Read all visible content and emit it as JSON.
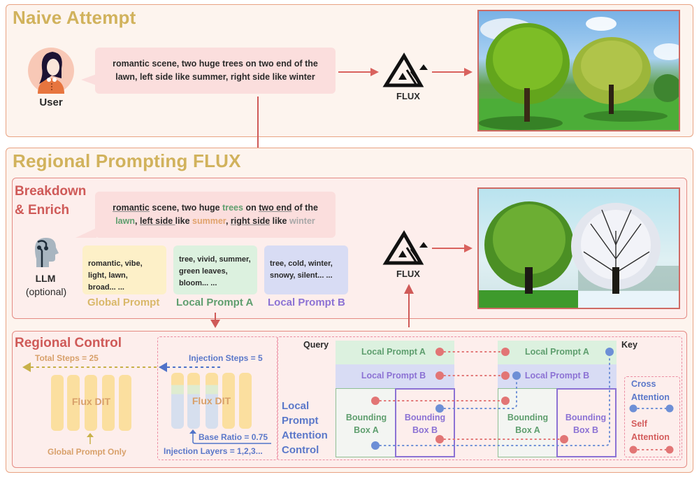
{
  "naive": {
    "title": "Naive Attempt",
    "user_label": "User",
    "prompt_line1": "romantic scene, two huge trees on two end of the",
    "prompt_line2": "lawn, left side like summer, right side like winter",
    "model_label": "FLUX",
    "output_image": "two-trees-summer-park-photo"
  },
  "regional": {
    "title": "Regional Prompting FLUX",
    "breakdown": {
      "title_line1": "Breakdown",
      "title_line2": "& Enrich",
      "prompt_tokens_line1": [
        {
          "text": "romantic",
          "style": "underline",
          "color": "#2a2a2a"
        },
        {
          "text": " scene, two huge ",
          "style": "plain",
          "color": "#2a2a2a"
        },
        {
          "text": "trees",
          "style": "plain",
          "color": "#5e9e6e"
        },
        {
          "text": " on ",
          "style": "plain",
          "color": "#2a2a2a"
        },
        {
          "text": "two end",
          "style": "underline",
          "color": "#2a2a2a"
        },
        {
          "text": " of the",
          "style": "plain",
          "color": "#2a2a2a"
        }
      ],
      "prompt_tokens_line2": [
        {
          "text": "lawn",
          "style": "plain",
          "color": "#5e9e6e"
        },
        {
          "text": ", ",
          "style": "plain",
          "color": "#2a2a2a"
        },
        {
          "text": "left side ",
          "style": "underline",
          "color": "#2a2a2a"
        },
        {
          "text": "like ",
          "style": "plain",
          "color": "#2a2a2a"
        },
        {
          "text": "summer",
          "style": "plain",
          "color": "#e0a36c"
        },
        {
          "text": ", ",
          "style": "plain",
          "color": "#2a2a2a"
        },
        {
          "text": "right side",
          "style": "underline",
          "color": "#2a2a2a"
        },
        {
          "text": " like ",
          "style": "plain",
          "color": "#2a2a2a"
        },
        {
          "text": "winter",
          "style": "plain",
          "color": "#a8a8a8"
        }
      ],
      "llm_label": "LLM",
      "llm_sub": "(optional)",
      "cards": [
        {
          "label": "Global Prompt",
          "text": "romantic, vibe,\nlight, lawn,\nbroad... ...",
          "bg": "#fdf0c8",
          "color": "#d9b869"
        },
        {
          "label": "Local Prompt A",
          "text": "tree, vivid, summer,\ngreen leaves,\nbloom... ...",
          "bg": "#dcf1df",
          "color": "#5e9e6e"
        },
        {
          "label": "Local Prompt B",
          "text": "tree, cold, winter,\nsnowy, silent... ...",
          "bg": "#d8dcf4",
          "color": "#8c72d4"
        }
      ],
      "model_label": "FLUX",
      "output_image": "summer-tree-and-winter-tree-photo"
    },
    "control": {
      "title": "Regional Control",
      "total_steps": "Total Steps = 25",
      "injection_steps": "Injection Steps = 5",
      "dit_label_left": "Flux DIT",
      "dit_label_right": "Flux DIT",
      "global_only": "Global Prompt Only",
      "base_ratio": "Base Ratio = 0.75",
      "injection_layers": "Injection Layers = 1,2,3...",
      "attention_title": [
        "Local",
        "Prompt",
        "Attention",
        "Control"
      ],
      "query_label": "Query",
      "key_label": "Key",
      "local_a": "Local Prompt A",
      "local_b": "Local Prompt B",
      "bbox_a": "Bounding\nBox A",
      "bbox_b": "Bounding\nBox B",
      "legend": {
        "cross": "Cross\nAttention",
        "self": "Self\nAttention"
      },
      "colors": {
        "self_attention": "#e27575",
        "cross_attention": "#6d8fd6",
        "green": "#5e9e6e",
        "purple": "#8c72d4",
        "blue_text": "#5b78c9",
        "orange_text": "#d8a06a"
      }
    }
  }
}
